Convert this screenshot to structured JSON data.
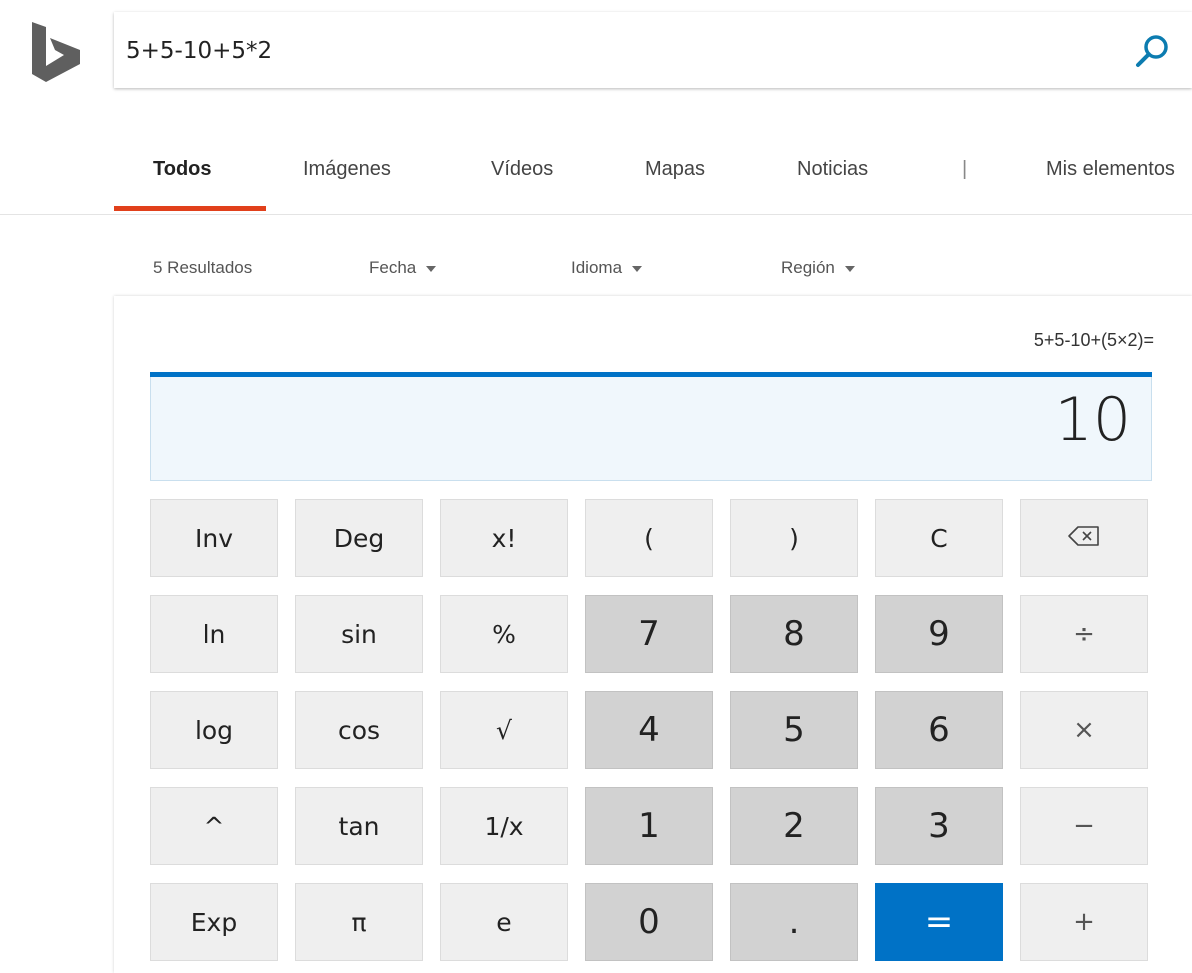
{
  "search": {
    "value": "5+5-10+5*2"
  },
  "nav": {
    "tabs": [
      {
        "label": "Todos",
        "active": true
      },
      {
        "label": "Imágenes"
      },
      {
        "label": "Vídeos"
      },
      {
        "label": "Mapas"
      },
      {
        "label": "Noticias"
      },
      {
        "label": "|"
      },
      {
        "label": "Mis elementos"
      }
    ],
    "accent_color": "#e1401b"
  },
  "filters": {
    "results": "5 Resultados",
    "items": [
      {
        "label": "Fecha"
      },
      {
        "label": "Idioma"
      },
      {
        "label": "Región"
      }
    ]
  },
  "calculator": {
    "expression": "5+5-10+(5×2)=",
    "result": "10",
    "accent_color": "#0072c6",
    "keys": [
      [
        "Inv",
        "Deg",
        "x!",
        "(",
        ")",
        "C",
        "⌫"
      ],
      [
        "ln",
        "sin",
        "%",
        "7",
        "8",
        "9",
        "÷"
      ],
      [
        "log",
        "cos",
        "√",
        "4",
        "5",
        "6",
        "×"
      ],
      [
        "^",
        "tan",
        "1/x",
        "1",
        "2",
        "3",
        "−"
      ],
      [
        "Exp",
        "π",
        "e",
        "0",
        ".",
        "=",
        "+"
      ]
    ]
  },
  "icons": {
    "logo": "bing-logo",
    "search": "search-icon",
    "backspace": "backspace-icon"
  }
}
